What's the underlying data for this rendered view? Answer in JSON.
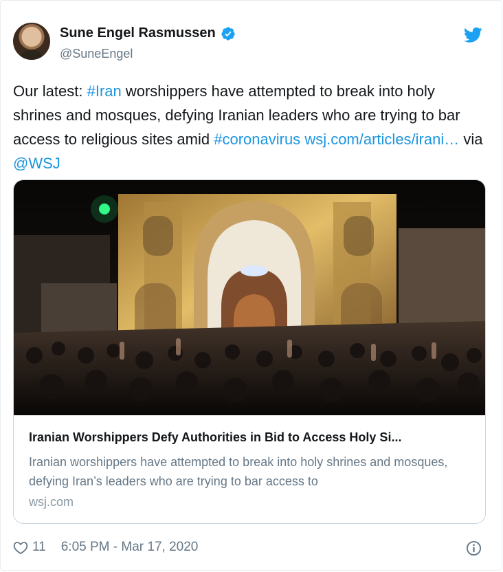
{
  "author": {
    "name": "Sune Engel Rasmussen",
    "handle": "@SuneEngel",
    "verified": true
  },
  "tweet": {
    "parts": [
      "Our latest: ",
      "#Iran",
      " worshippers have attempted to break into holy shrines and mosques, defying Iranian leaders who are trying to bar access to religious sites amid ",
      "#coronavirus",
      " ",
      "wsj.com/articles/irani…",
      " via ",
      "@WSJ"
    ]
  },
  "card": {
    "title": "Iranian Worshippers Defy Authorities in Bid to Access Holy Si...",
    "description": "Iranian worshippers have attempted to break into holy shrines and mosques, defying Iran’s leaders who are trying to bar access to",
    "domain": "wsj.com",
    "image_alt_icon": "shrine-photo"
  },
  "footer": {
    "likes": "11",
    "timestamp": "6:05 PM - Mar 17, 2020"
  },
  "icons": {
    "brand": "twitter-bird-icon",
    "verified": "verified-badge-icon",
    "like": "heart-icon",
    "info": "info-icon"
  },
  "colors": {
    "link": "#1b95e0",
    "brand": "#1da1f2",
    "text": "#14171a",
    "muted": "#657786"
  }
}
